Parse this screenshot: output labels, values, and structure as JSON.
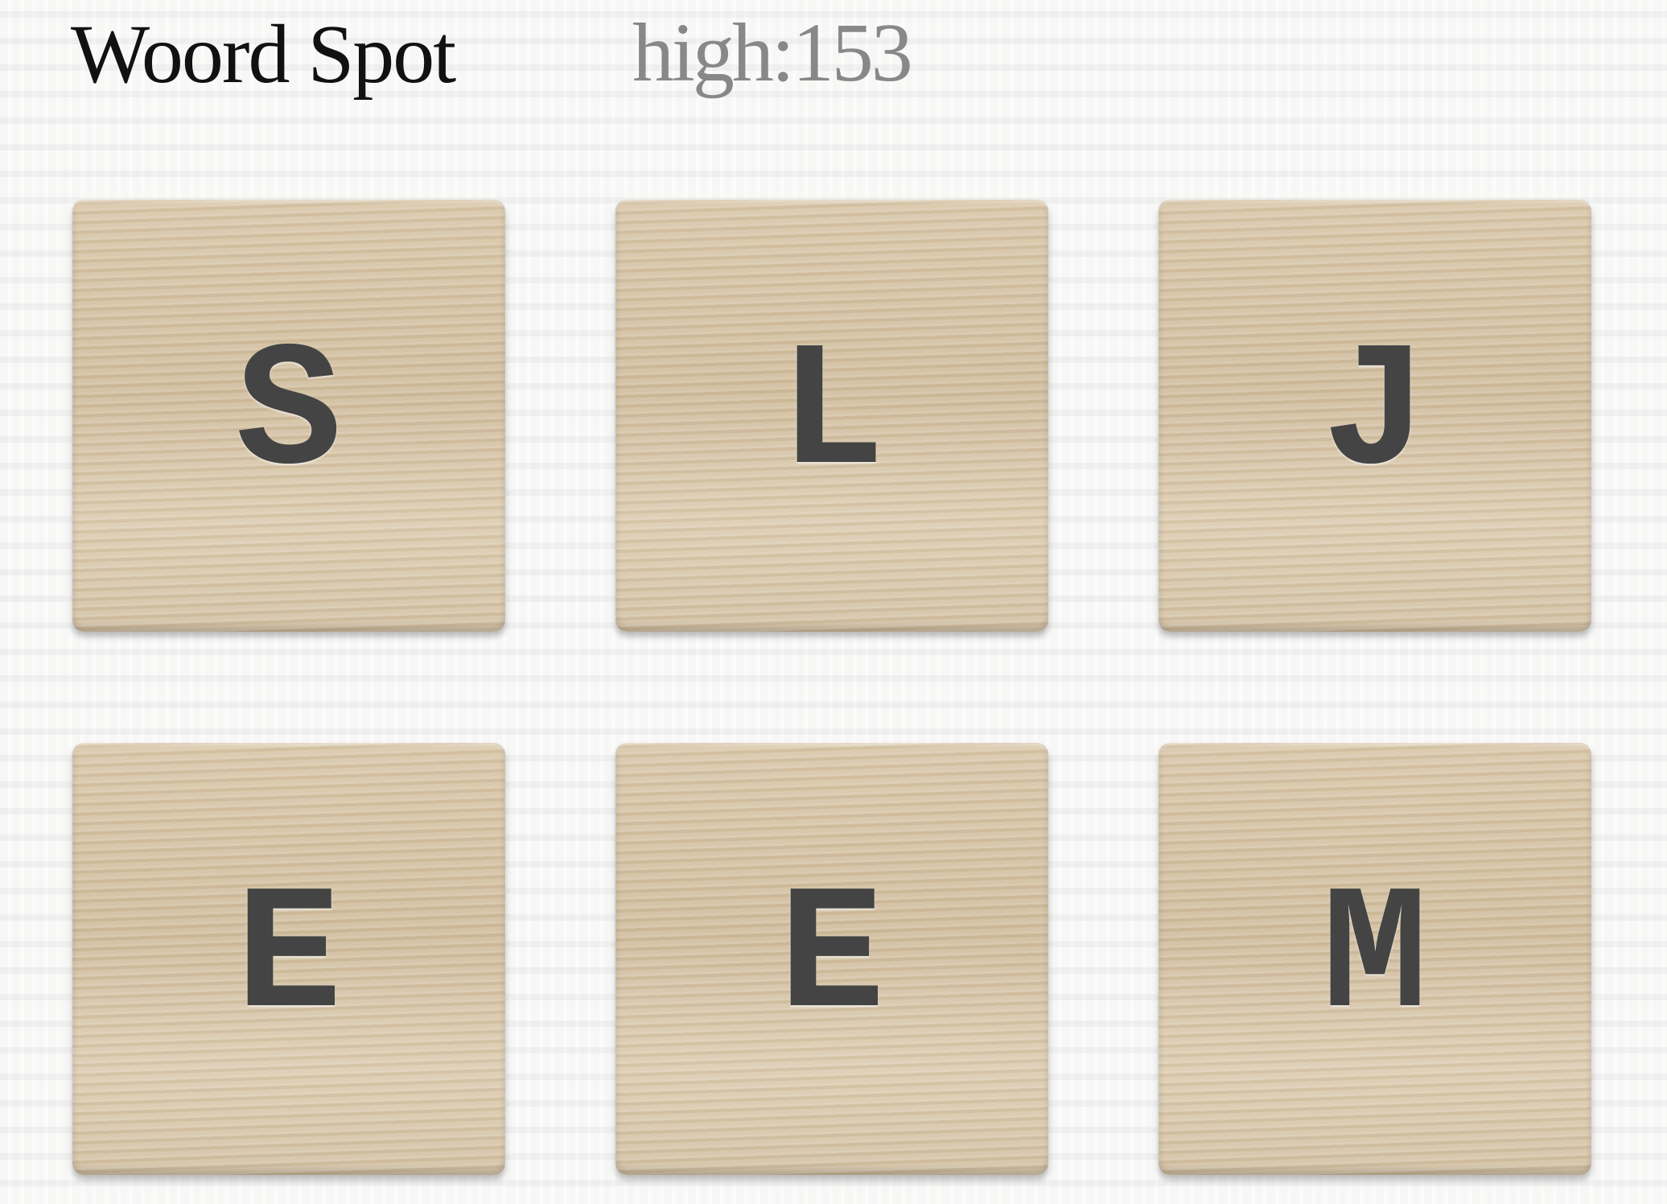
{
  "header": {
    "title": "Woord Spot",
    "high_score": "high:153"
  },
  "tiles": [
    {
      "letter": "S"
    },
    {
      "letter": "L"
    },
    {
      "letter": "J"
    },
    {
      "letter": "E"
    },
    {
      "letter": "E"
    },
    {
      "letter": "M"
    }
  ],
  "colors": {
    "tile": "#d4c2a4",
    "letter": "#444444",
    "title": "#111111",
    "high_score": "#888888"
  }
}
